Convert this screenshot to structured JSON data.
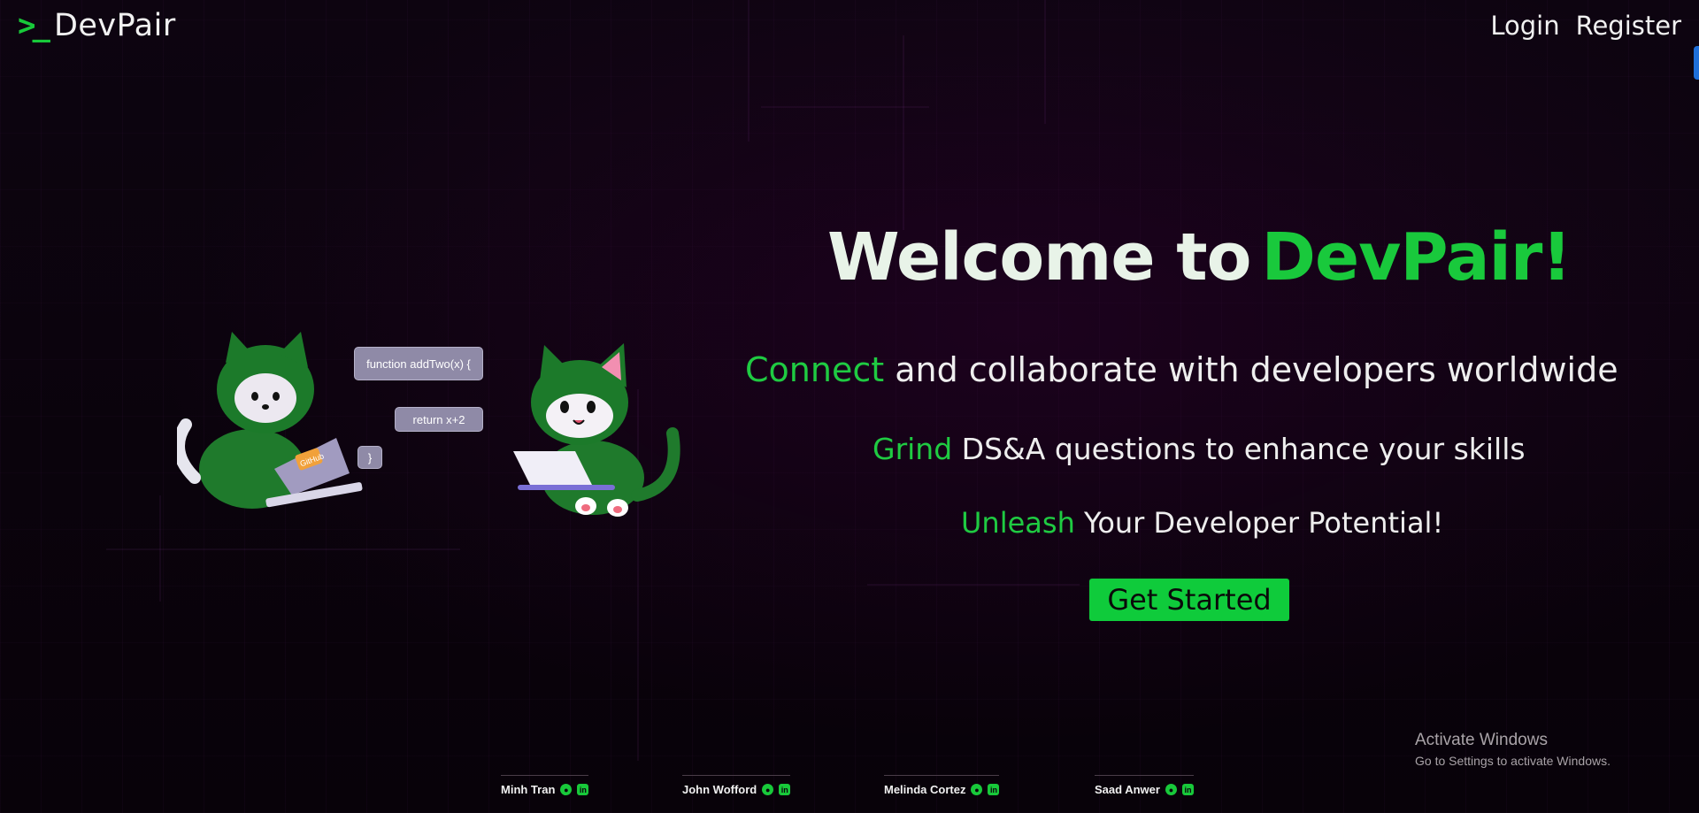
{
  "header": {
    "brand_prompt": ">_",
    "brand_name": "DevPair",
    "nav": {
      "login": "Login",
      "register": "Register"
    }
  },
  "hero": {
    "title_white": "Welcome to",
    "title_green": "DevPair!",
    "lines": [
      {
        "highlight": "Connect",
        "rest": " and collaborate with developers worldwide"
      },
      {
        "highlight": "Grind",
        "rest": " DS&A questions to enhance your skills"
      },
      {
        "highlight": "Unleash",
        "rest": " Your Developer Potential!"
      }
    ],
    "cta_label": "Get Started"
  },
  "illustration": {
    "bubble_1": "function addTwo(x) {",
    "bubble_2": "return x+2",
    "bubble_3": "}",
    "laptop_sticker": "GitHub"
  },
  "developers": [
    {
      "name": "Minh Tran",
      "icons": [
        "github-icon",
        "linkedin-icon"
      ]
    },
    {
      "name": "John Wofford",
      "icons": [
        "github-icon",
        "linkedin-icon"
      ]
    },
    {
      "name": "Melinda Cortez",
      "icons": [
        "github-icon",
        "linkedin-icon"
      ]
    },
    {
      "name": "Saad Anwer",
      "icons": [
        "github-icon",
        "linkedin-icon"
      ]
    }
  ],
  "watermark": {
    "title": "Activate Windows",
    "subtitle": "Go to Settings to activate Windows."
  },
  "colors": {
    "background": "#0b040d",
    "accent_green": "#19c93c",
    "text_light": "#eeeeee"
  }
}
